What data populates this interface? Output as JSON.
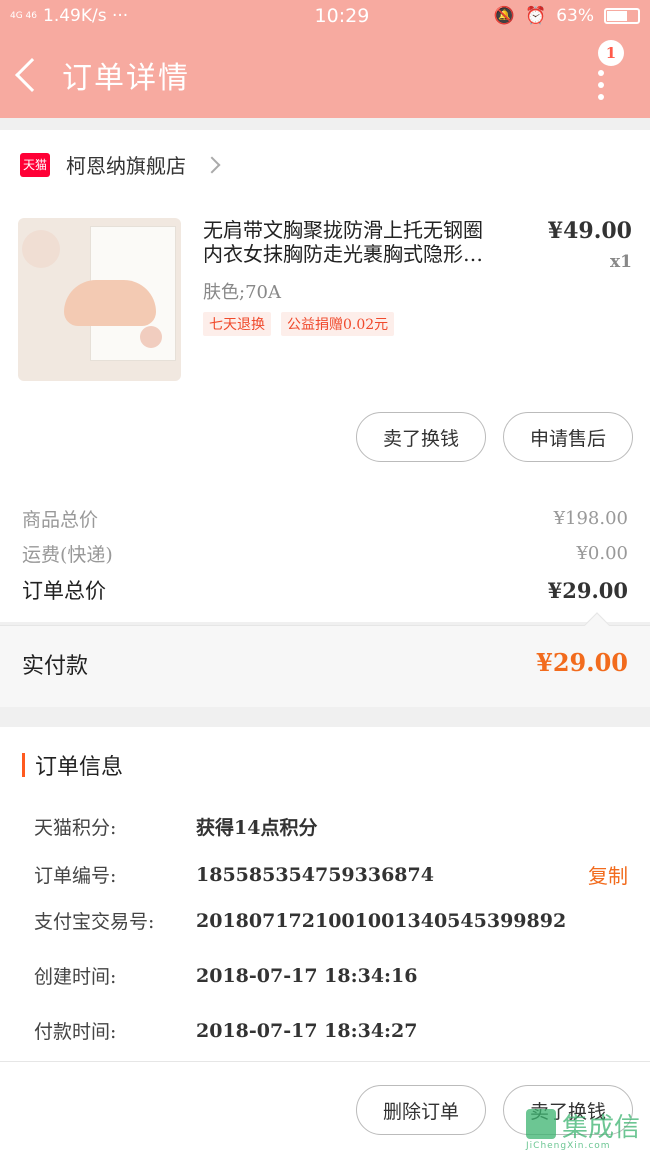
{
  "status": {
    "signal": "4G 46",
    "speed": "1.49K/s ···",
    "time": "10:29",
    "battery": "63%"
  },
  "header": {
    "title": "订单详情",
    "badge": "1"
  },
  "shop": {
    "badge": "天猫",
    "name": "柯恩纳旗舰店"
  },
  "product": {
    "title_line1": "无肩带文胸聚拢防滑上托无钢圈",
    "title_line2": "内衣女抹胸防走光裹胸式隐形…",
    "price": "¥49.00",
    "qty": "x1",
    "spec": "肤色;70A",
    "tags": [
      "七天退换",
      "公益捐赠0.02元"
    ]
  },
  "actions": {
    "sell": "卖了换钱",
    "after_sale": "申请售后",
    "delete": "删除订单",
    "sell2": "卖了换钱"
  },
  "summary": {
    "goods_label": "商品总价",
    "goods_value": "¥198.00",
    "ship_label": "运费(快递)",
    "ship_value": "¥0.00",
    "total_label": "订单总价",
    "total_value": "¥29.00"
  },
  "paid": {
    "label": "实付款",
    "value": "¥29.00"
  },
  "order_info": {
    "title": "订单信息",
    "rows": [
      {
        "k": "天猫积分:",
        "v": "获得14点积分"
      },
      {
        "k": "订单编号:",
        "v": "185585354759336874",
        "action": "复制"
      },
      {
        "k": "支付宝交易号:",
        "v": "2018071721001001340545399892"
      },
      {
        "k": "创建时间:",
        "v": "2018-07-17 18:34:16"
      },
      {
        "k": "付款时间:",
        "v": "2018-07-17 18:34:27"
      }
    ]
  },
  "watermark": {
    "text": "集成信",
    "url": "JiChengXin.com"
  },
  "colors": {
    "header": "#f7aaa0",
    "accent": "#f26b1d",
    "tmall": "#ff0036"
  }
}
